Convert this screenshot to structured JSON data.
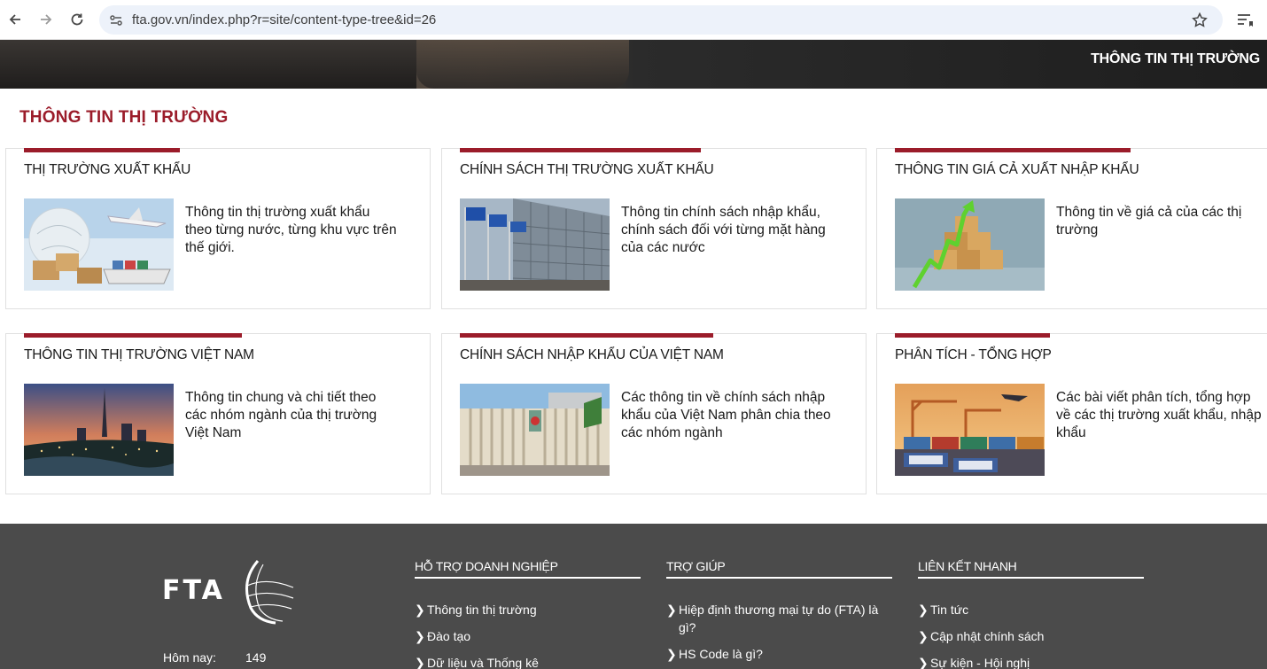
{
  "browser": {
    "url": "fta.gov.vn/index.php?r=site/content-type-tree&id=26"
  },
  "hero": {
    "title": "THÔNG TIN THỊ TRƯỜNG"
  },
  "page": {
    "title": "THÔNG TIN THỊ TRƯỜNG"
  },
  "cards": [
    {
      "title": "THỊ TRƯỜNG XUẤT KHẨU",
      "desc": "Thông tin thị trường xuất khẩu theo từng nước, từng khu vực trên thế giới.",
      "image": "globe-airplane-ship-image"
    },
    {
      "title": "CHÍNH SÁCH THỊ TRƯỜNG XUẤT KHẨU",
      "desc": "Thông tin chính sách nhập khẩu, chính sách đối với từng mặt hàng của các nước",
      "image": "eu-flags-building-image"
    },
    {
      "title": "THÔNG TIN GIÁ CẢ XUẤT NHẬP KHẨU",
      "desc": "Thông tin về giá cả của các thị trường",
      "image": "boxes-arrow-chart-image"
    },
    {
      "title": "THÔNG TIN THỊ TRƯỜNG VIỆT NAM",
      "desc": "Thông tin chung và chi tiết theo các nhóm ngành của thị trường Việt Nam",
      "image": "saigon-skyline-image"
    },
    {
      "title": "CHÍNH SÁCH NHẬP KHẨU CỦA VIỆT NAM",
      "desc": "Các thông tin về chính sách nhập khẩu của Việt Nam phân chia theo các nhóm ngành",
      "image": "national-assembly-building-image"
    },
    {
      "title": "PHÂN TÍCH - TỔNG HỢP",
      "desc": "Các bài viết phân tích, tổng hợp về các thị trường xuất khẩu, nhập khẩu",
      "image": "import-export-port-image"
    }
  ],
  "footer": {
    "logo": "FTA",
    "counter_label": "Hôm nay:",
    "counter_value": "149",
    "columns": [
      {
        "title": "HỖ TRỢ DOANH NGHIỆP",
        "items": [
          "Thông tin thị trường",
          "Đào tạo",
          "Dữ liệu và Thống kê"
        ]
      },
      {
        "title": "TRỢ GIÚP",
        "items": [
          "Hiệp định thương mại tự do (FTA) là gì?",
          "HS Code là gì?"
        ]
      },
      {
        "title": "LIÊN KẾT NHANH",
        "items": [
          "Tin tức",
          "Cập nhật chính sách",
          "Sự kiện - Hội nghị"
        ]
      }
    ]
  },
  "colors": {
    "accent": "#9b1c2a",
    "footer_bg": "#4b4b4b"
  }
}
